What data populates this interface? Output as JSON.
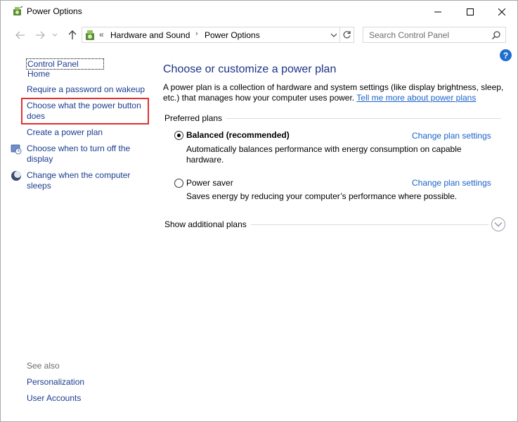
{
  "window": {
    "title": "Power Options"
  },
  "nav": {
    "breadcrumbs": [
      "Hardware and Sound",
      "Power Options"
    ],
    "overflow_chevrons": "«",
    "search_placeholder": "Search Control Panel"
  },
  "sidebar": {
    "home": "Control Panel Home",
    "items": [
      {
        "label_line1": "Require a password on wakeup",
        "label_line2": ""
      },
      {
        "label_line1": "Choose what the power button",
        "label_line2": "does"
      },
      {
        "label_line1": "Create a power plan",
        "label_line2": ""
      },
      {
        "label_line1": "Choose when to turn off the",
        "label_line2": "display"
      },
      {
        "label_line1": "Change when the computer",
        "label_line2": "sleeps"
      }
    ],
    "see_also": "See also",
    "see_also_links": [
      "Personalization",
      "User Accounts"
    ]
  },
  "main": {
    "heading": "Choose or customize a power plan",
    "description_line1": "A power plan is a collection of hardware and system settings (like display brightness, sleep,",
    "description_line2": "etc.) that manages how your computer uses power.",
    "learn_more": "Tell me more about power plans",
    "preferred_plans_label": "Preferred plans",
    "plans": [
      {
        "name": "Balanced (recommended)",
        "selected": true,
        "desc_line1": "Automatically balances performance with energy consumption on capable",
        "desc_line2": "hardware.",
        "change_link": "Change plan settings"
      },
      {
        "name": "Power saver",
        "selected": false,
        "desc_line1": "Saves energy by reducing your computer’s performance where possible.",
        "desc_line2": "",
        "change_link": "Change plan settings"
      }
    ],
    "additional_plans_label": "Show additional plans"
  },
  "help_label": "?",
  "colors": {
    "link": "#1a63c8",
    "heading": "#1e3287",
    "highlight": "#e03030"
  }
}
